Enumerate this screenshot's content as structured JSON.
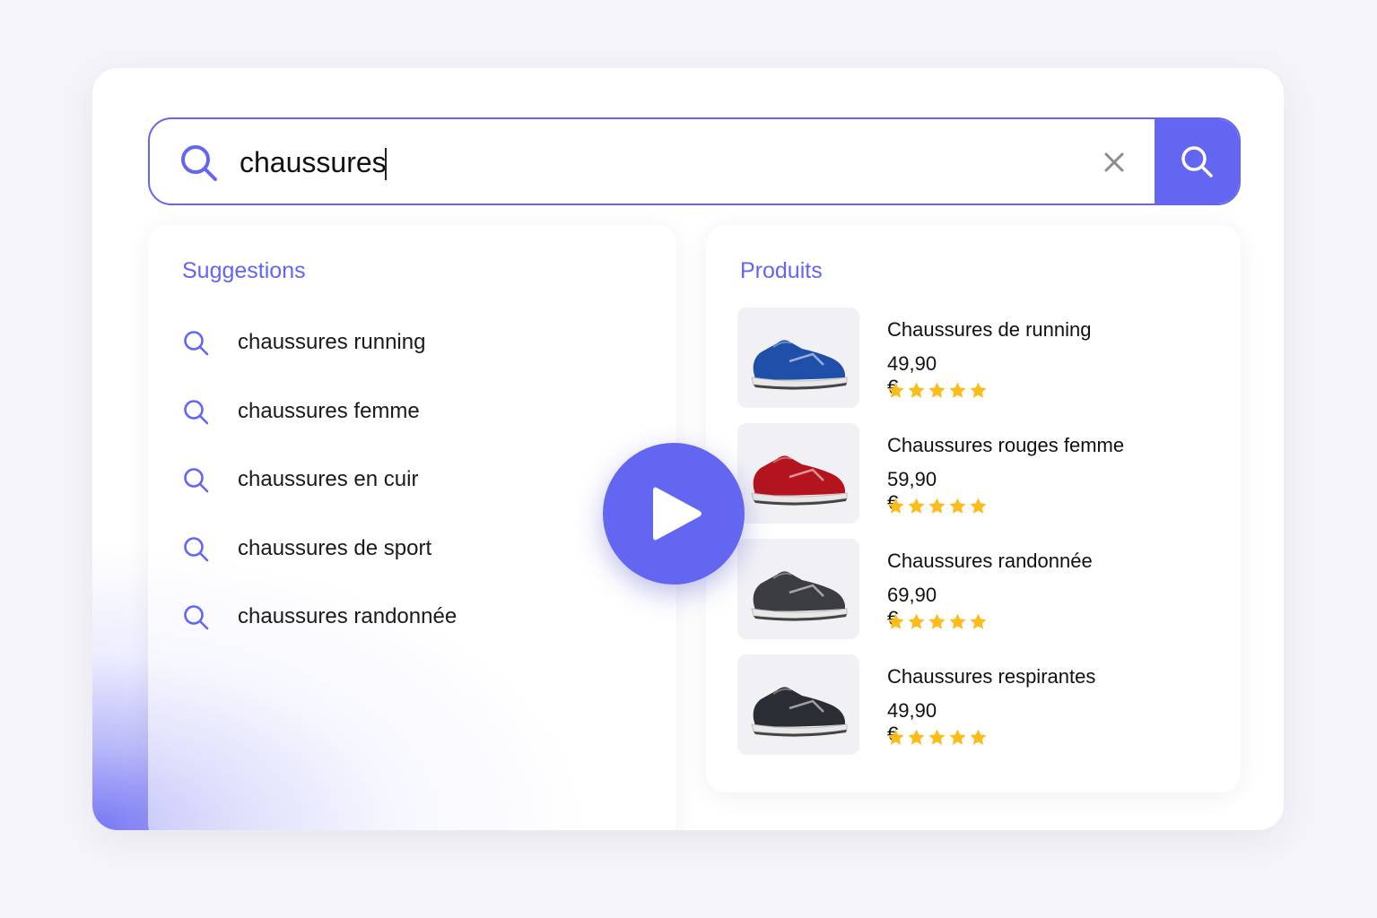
{
  "search": {
    "query": "chaussures",
    "clear_icon": "close-icon",
    "submit_icon": "search-icon"
  },
  "suggestions": {
    "title": "Suggestions",
    "items": [
      {
        "label": "chaussures running"
      },
      {
        "label": "chaussures femme"
      },
      {
        "label": "chaussures en cuir"
      },
      {
        "label": "chaussures de sport"
      },
      {
        "label": "chaussures randonnée"
      }
    ]
  },
  "products": {
    "title": "Produits",
    "items": [
      {
        "name": "Chaussures de running",
        "price": "49,90 €",
        "rating": 5,
        "rating_max": 5,
        "shoe_color": "#1f4fa8"
      },
      {
        "name": "Chaussures rouges femme",
        "price": "59,90 €",
        "rating": 5,
        "rating_max": 5,
        "shoe_color": "#b3141e"
      },
      {
        "name": "Chaussures randonnée",
        "price": "69,90 €",
        "rating": 5,
        "rating_max": 5,
        "shoe_color": "#3b3d42"
      },
      {
        "name": "Chaussures respirantes",
        "price": "49,90 €",
        "rating": 5,
        "rating_max": 5,
        "shoe_color": "#2a2d33"
      }
    ]
  },
  "colors": {
    "accent": "#6366f1",
    "star": "#fbbc1c"
  },
  "play_icon": "play-icon"
}
